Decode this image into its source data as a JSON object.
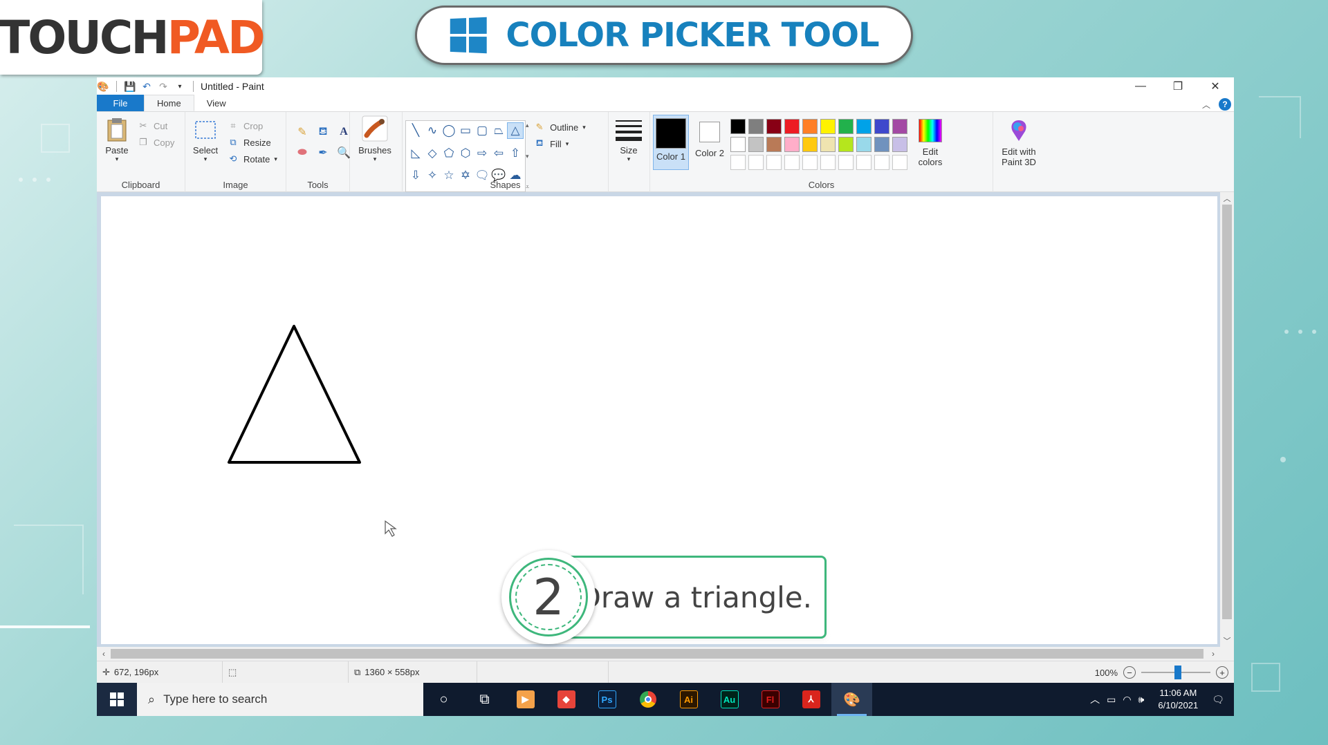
{
  "brand": {
    "logo_part1": "TOUCH",
    "logo_part2": "PAD"
  },
  "banner": {
    "title": "COLOR PICKER TOOL"
  },
  "window": {
    "title": "Untitled - Paint",
    "controls": {
      "minimize": "—",
      "restore": "❐",
      "close": "✕"
    }
  },
  "tabs": {
    "file": "File",
    "home": "Home",
    "view": "View"
  },
  "ribbon": {
    "clipboard": {
      "label": "Clipboard",
      "paste": "Paste",
      "cut": "Cut",
      "copy": "Copy"
    },
    "image": {
      "label": "Image",
      "select": "Select",
      "crop": "Crop",
      "resize": "Resize",
      "rotate": "Rotate"
    },
    "tools": {
      "label": "Tools"
    },
    "brushes": {
      "label": "Brushes"
    },
    "shapes": {
      "label": "Shapes",
      "outline": "Outline",
      "fill": "Fill"
    },
    "size": {
      "label": "Size"
    },
    "colors": {
      "label": "Colors",
      "color1": "Color 1",
      "color2": "Color 2",
      "color1_value": "#000000",
      "color2_value": "#ffffff",
      "edit_colors": "Edit colors",
      "edit_paint3d": "Edit with Paint 3D",
      "palette": [
        "#000000",
        "#7f7f7f",
        "#880015",
        "#ed1c24",
        "#ff7f27",
        "#fff200",
        "#22b14c",
        "#00a2e8",
        "#3f48cc",
        "#a349a4",
        "#ffffff",
        "#c3c3c3",
        "#b97a57",
        "#ffaec9",
        "#ffc90e",
        "#efe4b0",
        "#b5e61d",
        "#99d9ea",
        "#7092be",
        "#c8bfe7",
        "#ffffff",
        "#ffffff",
        "#ffffff",
        "#ffffff",
        "#ffffff",
        "#ffffff",
        "#ffffff",
        "#ffffff",
        "#ffffff",
        "#ffffff"
      ]
    }
  },
  "status": {
    "cursor_pos": "672, 196px",
    "canvas_size": "1360 × 558px",
    "zoom": "100%"
  },
  "taskbar": {
    "search_placeholder": "Type here to search",
    "apps": [
      "Ps",
      "Ai",
      "Au",
      "Fl"
    ],
    "time": "11:06 AM",
    "date": "6/10/2021"
  },
  "callout": {
    "step_number": "2",
    "text": "Draw a triangle."
  }
}
